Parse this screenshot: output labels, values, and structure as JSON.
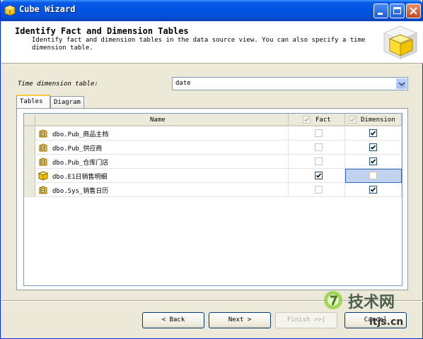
{
  "window": {
    "title": "Cube Wizard"
  },
  "header": {
    "title": "Identify Fact and Dimension Tables",
    "description": "Identify fact and dimension tables in the data source view. You can also specify a time dimension table."
  },
  "time_dimension": {
    "label": "Time dimension table:",
    "value": "date"
  },
  "tabs": [
    {
      "label": "Tables",
      "active": true
    },
    {
      "label": "Diagram",
      "active": false
    }
  ],
  "grid": {
    "columns": {
      "name": "Name",
      "fact": "Fact",
      "dimension": "Dimension"
    },
    "rows": [
      {
        "name": "dbo.Pub_商品主档",
        "fact": false,
        "dimension": true,
        "icon": "dimension-table-icon"
      },
      {
        "name": "dbo.Pub_供应商",
        "fact": false,
        "dimension": true,
        "icon": "dimension-table-icon"
      },
      {
        "name": "dbo.Pub_仓库门店",
        "fact": false,
        "dimension": true,
        "icon": "dimension-table-icon"
      },
      {
        "name": "dbo.E1日销售明细",
        "fact": true,
        "dimension": false,
        "icon": "fact-table-icon"
      },
      {
        "name": "dbo.Sys_销售日历",
        "fact": false,
        "dimension": true,
        "icon": "dimension-table-icon"
      }
    ]
  },
  "buttons": {
    "back": "Back",
    "next": "Next",
    "finish": "Finish",
    "cancel": "Cancel"
  },
  "watermark": {
    "text_cn": "技术网",
    "site": "itjs.cn"
  },
  "colors": {
    "titlebar": "#0054e3",
    "panel": "#ece9d8",
    "selection": "#c2d3ef",
    "tab_accent": "#ffc83c"
  }
}
